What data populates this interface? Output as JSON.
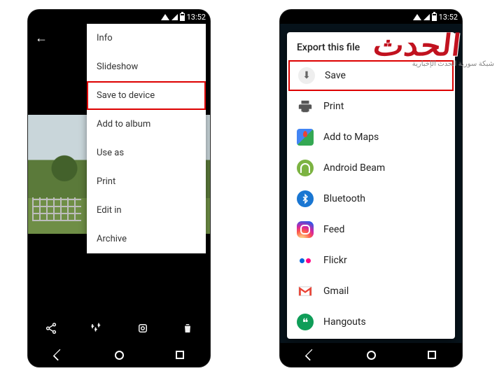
{
  "status": {
    "time": "13:52"
  },
  "phone1": {
    "menu": {
      "items": [
        {
          "label": "Info"
        },
        {
          "label": "Slideshow"
        },
        {
          "label": "Save to device",
          "highlight": true
        },
        {
          "label": "Add to album"
        },
        {
          "label": "Use as"
        },
        {
          "label": "Print"
        },
        {
          "label": "Edit in"
        },
        {
          "label": "Archive"
        }
      ]
    }
  },
  "phone2": {
    "sheet_title": "Export this file",
    "share": {
      "items": [
        {
          "icon": "download",
          "label": "Save",
          "highlight": true
        },
        {
          "icon": "print",
          "label": "Print"
        },
        {
          "icon": "maps",
          "label": "Add to Maps"
        },
        {
          "icon": "beam",
          "label": "Android Beam"
        },
        {
          "icon": "bluetooth",
          "label": "Bluetooth"
        },
        {
          "icon": "instagram",
          "label": "Feed"
        },
        {
          "icon": "flickr",
          "label": "Flickr"
        },
        {
          "icon": "gmail",
          "label": "Gmail"
        },
        {
          "icon": "hangouts",
          "label": "Hangouts"
        }
      ]
    }
  },
  "watermark": {
    "main": "الحدث",
    "sub": "شبكة سورية الحدث الإخبارية"
  }
}
